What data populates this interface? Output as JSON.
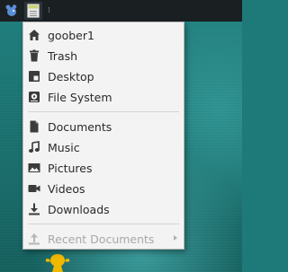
{
  "panel": {
    "whisker_icon": "whisker-mouse-icon",
    "places_icon": "places-drive-icon",
    "separator": "⁞"
  },
  "menu": {
    "group1": [
      {
        "label": "goober1",
        "icon": "home-icon"
      },
      {
        "label": "Trash",
        "icon": "trash-icon"
      },
      {
        "label": "Desktop",
        "icon": "desktop-icon"
      },
      {
        "label": "File System",
        "icon": "drive-icon"
      }
    ],
    "group2": [
      {
        "label": "Documents",
        "icon": "document-icon"
      },
      {
        "label": "Music",
        "icon": "music-icon"
      },
      {
        "label": "Pictures",
        "icon": "image-icon"
      },
      {
        "label": "Videos",
        "icon": "video-icon"
      },
      {
        "label": "Downloads",
        "icon": "download-icon"
      }
    ],
    "group3": [
      {
        "label": "Recent Documents",
        "icon": "recent-icon",
        "disabled": true
      }
    ]
  },
  "colors": {
    "panel_bg": "#1a1f22",
    "menu_bg": "#f3f3f3",
    "icon": "#3b3b3b",
    "desktop_teal": "#1e7a78"
  }
}
